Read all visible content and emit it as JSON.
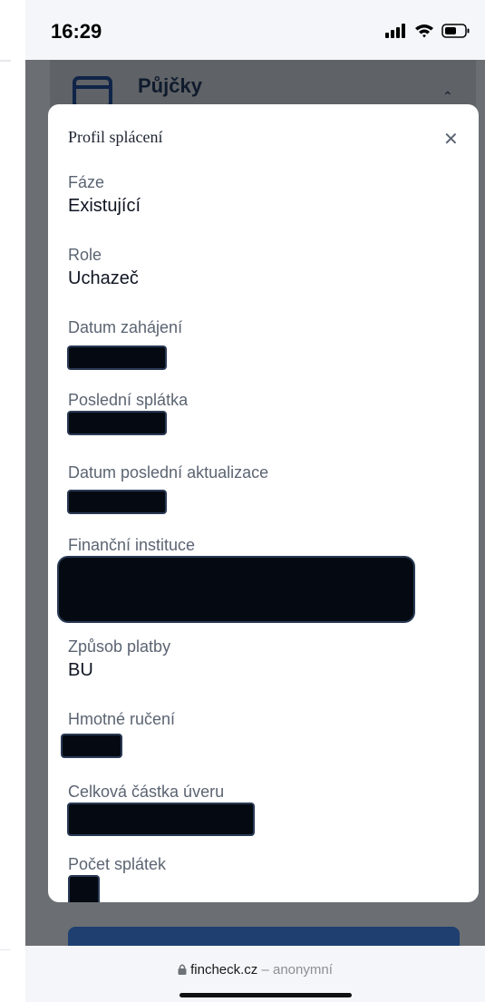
{
  "status": {
    "time": "16:29"
  },
  "background_page": {
    "section_title": "Půjčky"
  },
  "modal": {
    "title": "Profil splácení",
    "fields": [
      {
        "label": "Fáze",
        "value": "Existující"
      },
      {
        "label": "Role",
        "value": "Uchazeč"
      },
      {
        "label": "Datum zahájení"
      },
      {
        "label": "Poslední splátka"
      },
      {
        "label": "Datum poslední aktualizace"
      },
      {
        "label": "Finanční instituce"
      },
      {
        "label": "Způsob platby",
        "value": "BU"
      },
      {
        "label": "Hmotné ručení"
      },
      {
        "label": "Celková částka úveru"
      },
      {
        "label": "Počet splátek"
      }
    ]
  },
  "browser": {
    "domain": "fincheck.cz",
    "separator": " – ",
    "mode": "anonymní"
  }
}
